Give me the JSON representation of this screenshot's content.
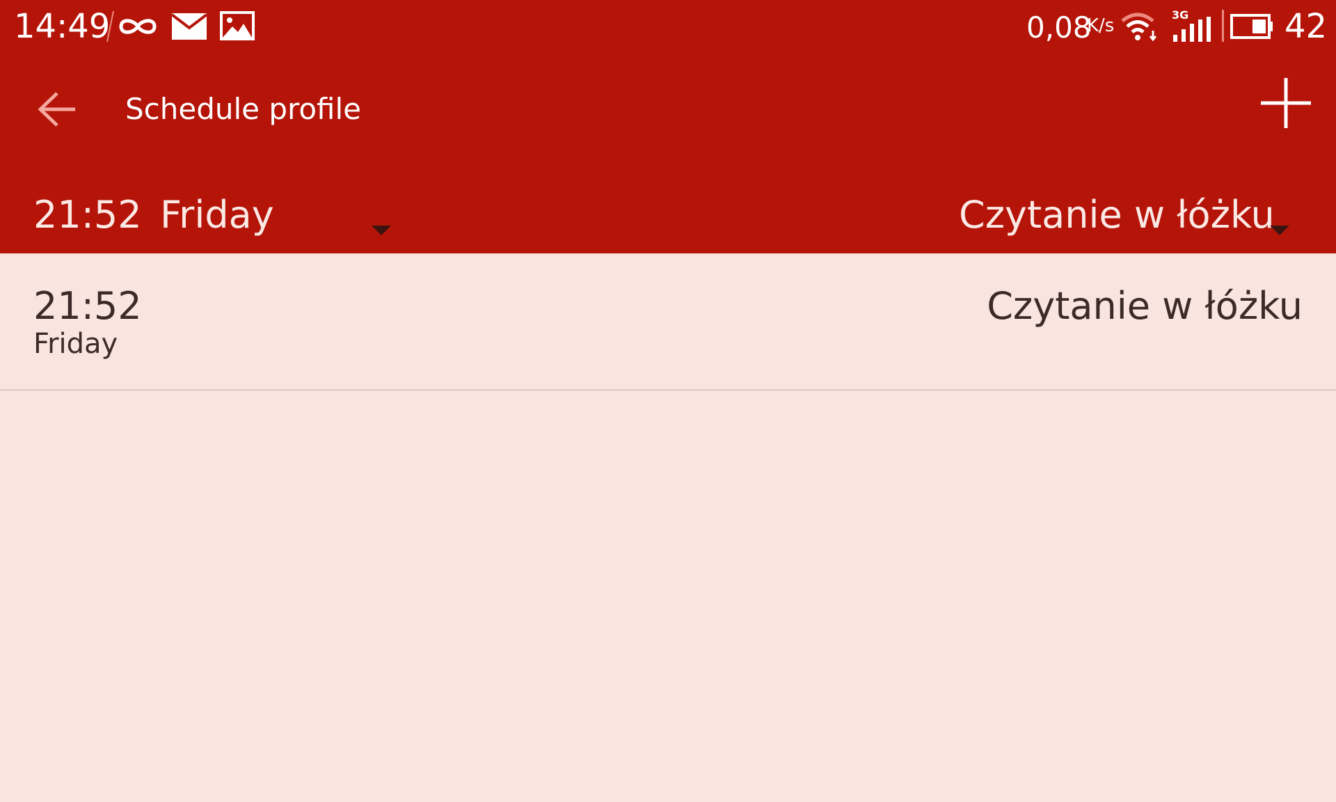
{
  "status_bar": {
    "time": "14:49",
    "speed_value": "0,08",
    "speed_unit": "K/s",
    "network_type": "3G",
    "battery_level": "42",
    "icons": [
      "infinity-icon",
      "mail-icon",
      "image-icon",
      "wifi-icon",
      "signal-icon",
      "battery-icon"
    ]
  },
  "app_bar": {
    "title": "Schedule profile",
    "back_icon": "back-arrow-icon",
    "add_icon": "plus-icon"
  },
  "editor": {
    "time": "21:52",
    "day": "Friday",
    "profile": "Czytanie w łóżku"
  },
  "schedule": {
    "items": [
      {
        "time": "21:52",
        "day": "Friday",
        "profile": "Czytanie w łóżku"
      }
    ]
  },
  "colors": {
    "primary": "#b51408",
    "background": "#f9e4df",
    "text_dark": "#3b2a28",
    "text_light": "#ffffff"
  }
}
